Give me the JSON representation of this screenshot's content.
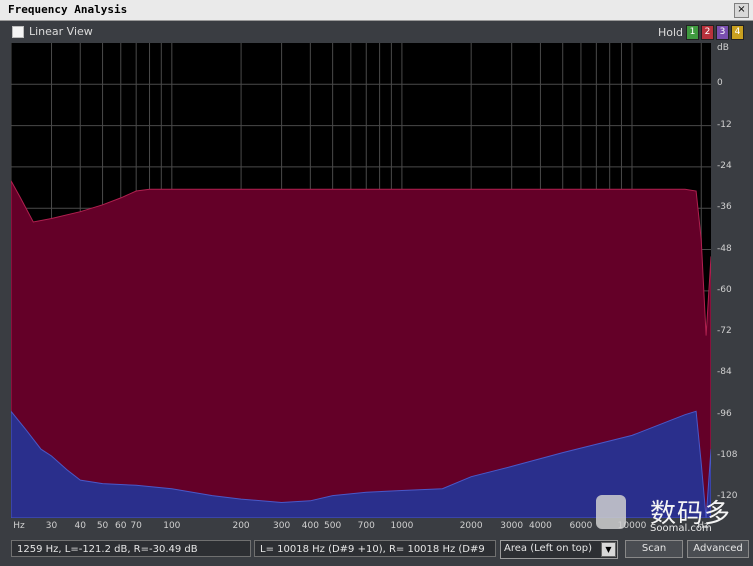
{
  "window": {
    "title": "Frequency Analysis",
    "close_glyph": "×"
  },
  "toolbar": {
    "linear_view_label": "Linear View",
    "linear_view_checked": false,
    "hold_label": "Hold",
    "hold_buttons": [
      {
        "label": "1",
        "color": "#3f9a3f"
      },
      {
        "label": "2",
        "color": "#b8323c"
      },
      {
        "label": "3",
        "color": "#7a4fb0"
      },
      {
        "label": "4",
        "color": "#c9a020"
      }
    ]
  },
  "chart_data": {
    "type": "area",
    "x_scale": "log",
    "x_unit": "Hz",
    "y_unit": "dB",
    "ylim": [
      -126,
      12
    ],
    "xlim": [
      20,
      22050
    ],
    "grid": true,
    "y_ticks": [
      0,
      -12,
      -24,
      -36,
      -48,
      -60,
      -72,
      -84,
      -96,
      -108,
      -120
    ],
    "x_tick_labels": [
      "Hz",
      "30",
      "40",
      "50",
      "60",
      "70",
      "100",
      "200",
      "300",
      "400",
      "500",
      "700",
      "1000",
      "2000",
      "3000",
      "4000",
      "6000",
      "10000",
      "Hz"
    ],
    "series": [
      {
        "color": "#640028",
        "x": [
          20,
          22,
          25,
          30,
          40,
          50,
          60,
          70,
          80,
          100,
          150,
          300,
          1000,
          3000,
          10000,
          17000,
          19000,
          20000,
          21000,
          22050
        ],
        "y": [
          -28,
          -33,
          -40,
          -39,
          -37,
          -35,
          -33,
          -31,
          -30.5,
          -30.5,
          -30.5,
          -30.5,
          -30.5,
          -30.5,
          -30.5,
          -30.5,
          -31,
          -45,
          -73,
          -50
        ]
      },
      {
        "color": "#2a2f8c",
        "x": [
          20,
          23,
          27,
          30,
          35,
          40,
          50,
          70,
          100,
          150,
          200,
          300,
          400,
          500,
          700,
          1000,
          1500,
          2000,
          3000,
          5000,
          10000,
          17000,
          19000,
          20000,
          21000,
          22050
        ],
        "y": [
          -95,
          -100,
          -106,
          -108,
          -112,
          -115,
          -116,
          -116.5,
          -117.5,
          -119.5,
          -120.5,
          -121.5,
          -121,
          -119.5,
          -118.5,
          -118,
          -117.5,
          -114,
          -111,
          -107,
          -102,
          -96,
          -95,
          -110,
          -126,
          -106
        ]
      }
    ]
  },
  "status": {
    "cursor_readout": "1259 Hz, L=-121.2 dB, R=-30.49 dB",
    "peak_readout": "L=  10018 Hz (D#9 +10), R=  10018 Hz (D#9",
    "view_mode": "Area (Left on top)",
    "scan_label": "Scan",
    "advanced_label": "Advanced"
  },
  "watermark": {
    "cn_text": "数码多",
    "en_text": "Soomal.com"
  }
}
